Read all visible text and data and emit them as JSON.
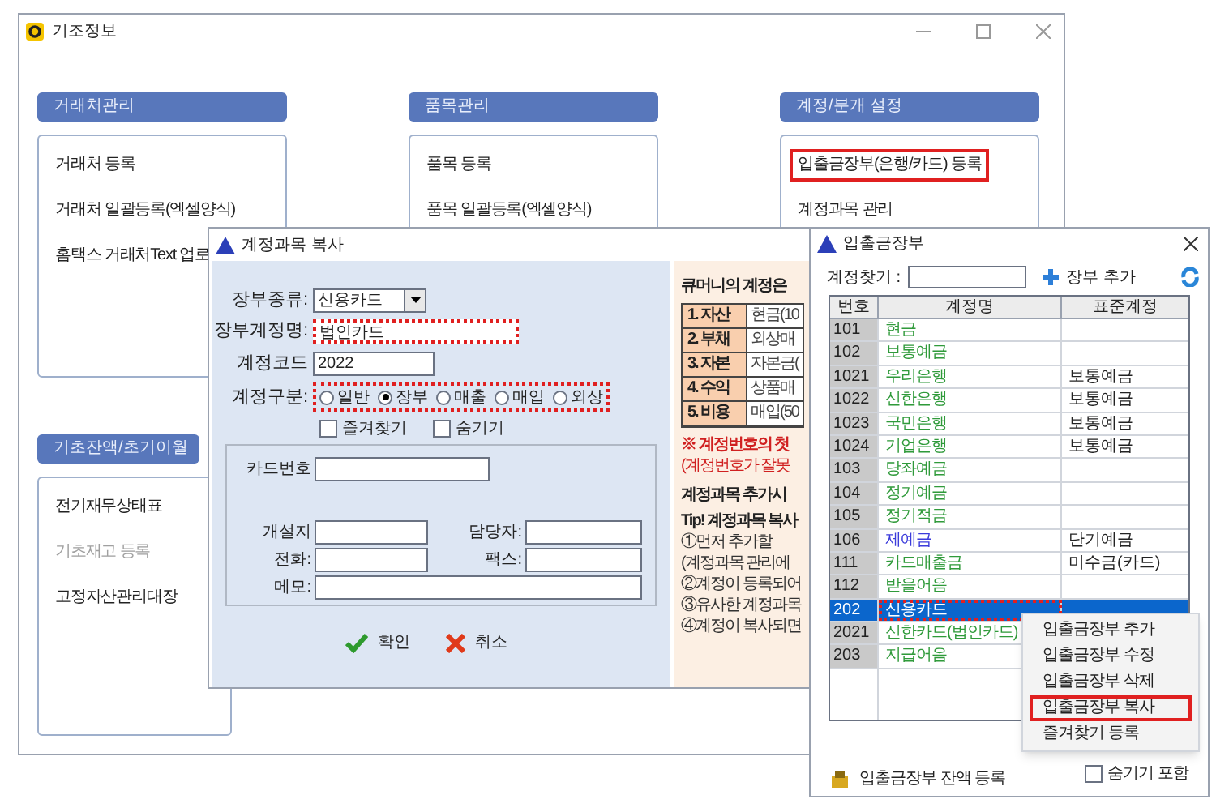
{
  "window": {
    "title": "기조정보"
  },
  "sections": [
    {
      "title": "거래처관리",
      "items": [
        {
          "label": "거래처 등록",
          "disabled": false,
          "highlighted": false
        },
        {
          "label": "거래처 일괄등록(엑셀양식)",
          "disabled": false,
          "highlighted": false
        },
        {
          "label": "홈택스 거래처Text 업로",
          "disabled": false,
          "highlighted": false
        }
      ]
    },
    {
      "title": "품목관리",
      "items": [
        {
          "label": "품목 등록",
          "disabled": false,
          "highlighted": false
        },
        {
          "label": "품목 일괄등록(엑셀양식)",
          "disabled": false,
          "highlighted": false
        }
      ]
    },
    {
      "title": "계정/분개 설정",
      "items": [
        {
          "label": "입출금장부(은행/카드) 등록",
          "disabled": false,
          "highlighted": true
        },
        {
          "label": "계정과목 관리",
          "disabled": false,
          "highlighted": false
        }
      ]
    },
    {
      "title": "기초잔액/초기이월",
      "items": [
        {
          "label": "전기재무상태표",
          "disabled": false,
          "highlighted": false
        },
        {
          "label": "기초재고 등록",
          "disabled": true,
          "highlighted": false
        },
        {
          "label": "고정자산관리대장",
          "disabled": false,
          "highlighted": false
        }
      ]
    }
  ],
  "copy_dialog": {
    "title": "계정과목 복사",
    "book_type": {
      "label": "장부종류:",
      "value": "신용카드"
    },
    "account_name": {
      "label": "장부계정명:",
      "value": "법인카드",
      "highlighted": true
    },
    "account_code": {
      "label": "계정코드",
      "value": "2022"
    },
    "account_class": {
      "label": "계정구분:",
      "highlighted": true,
      "options": [
        {
          "label": "일반",
          "selected": false
        },
        {
          "label": "장부",
          "selected": true
        },
        {
          "label": "매출",
          "selected": false
        },
        {
          "label": "매입",
          "selected": false
        },
        {
          "label": "외상",
          "selected": false
        }
      ]
    },
    "checkboxes": [
      {
        "label": "즐겨찾기",
        "checked": false
      },
      {
        "label": "숨기기",
        "checked": false
      }
    ],
    "card_number": {
      "label": "카드번호"
    },
    "fields": [
      {
        "label": "개설지"
      },
      {
        "label": "담당자:"
      },
      {
        "label": "전화:"
      },
      {
        "label": "팩스:"
      },
      {
        "label": "메모:"
      }
    ],
    "buttons": [
      {
        "label": "확인",
        "kind": "ok"
      },
      {
        "label": "취소",
        "kind": "cancel"
      }
    ],
    "guide": {
      "title": "큐머니의 계정은",
      "rows": [
        {
          "group": "1. 자산",
          "example": "현금(10"
        },
        {
          "group": "2. 부채",
          "example": "외상매"
        },
        {
          "group": "3. 자본",
          "example": "자본금("
        },
        {
          "group": "4. 수익",
          "example": "상품매"
        },
        {
          "group": "5. 비용",
          "example": "매입(50"
        }
      ],
      "warning": [
        "※ 계정번호의 첫",
        "(계정번호가 잘못"
      ],
      "heading": "계정과목 추가시",
      "tip_title": "Tip! 계정과목 복사",
      "tips": [
        "①먼저 추가할",
        "(계정과목 관리에",
        "②계정이 등록되어",
        "③유사한 계정과목",
        "④계정이 복사되면"
      ]
    }
  },
  "ledger_window": {
    "title": "입출금장부",
    "search_label": "계정찾기 :",
    "add_button": "장부 추가",
    "columns": [
      "번호",
      "계정명",
      "표준계정"
    ],
    "rows": [
      {
        "code": "101",
        "name": "현금",
        "color": "#2f9a3a",
        "selected": false
      },
      {
        "code": "102",
        "name": "보통예금",
        "color": "#2f9a3a",
        "selected": false
      },
      {
        "code": "1021",
        "name": "우리은행",
        "standard": "보통예금",
        "color": "#2f9a3a",
        "selected": false
      },
      {
        "code": "1022",
        "name": "신한은행",
        "standard": "보통예금",
        "color": "#2f9a3a",
        "selected": false
      },
      {
        "code": "1023",
        "name": "국민은행",
        "standard": "보통예금",
        "color": "#2f9a3a",
        "selected": false
      },
      {
        "code": "1024",
        "name": "기업은행",
        "standard": "보통예금",
        "color": "#2f9a3a",
        "selected": false
      },
      {
        "code": "103",
        "name": "당좌예금",
        "color": "#2f9a3a",
        "selected": false
      },
      {
        "code": "104",
        "name": "정기예금",
        "color": "#2f9a3a",
        "selected": false
      },
      {
        "code": "105",
        "name": "정기적금",
        "color": "#2f9a3a",
        "selected": false
      },
      {
        "code": "106",
        "name": "제예금",
        "standard": "단기예금",
        "color": "#3b3bdb",
        "selected": false
      },
      {
        "code": "111",
        "name": "카드매출금",
        "standard": "미수금(카드)",
        "color": "#2f9a3a",
        "selected": false
      },
      {
        "code": "112",
        "name": "받을어음",
        "color": "#2f9a3a",
        "selected": false
      },
      {
        "code": "202",
        "name": "신용카드",
        "selected": true
      },
      {
        "code": "2021",
        "name": "신한카드(법인카드)",
        "color": "#2f9a3a",
        "selected": false
      },
      {
        "code": "203",
        "name": "지급어음",
        "color": "#2f9a3a",
        "selected": false
      }
    ],
    "balance_button": "입출금장부 잔액 등록",
    "hidden_checkbox": {
      "label": "숨기기 포함",
      "checked": false
    }
  },
  "context_menu": [
    {
      "label": "입출금장부 추가",
      "highlighted": false
    },
    {
      "label": "입출금장부 수정",
      "highlighted": false
    },
    {
      "label": "입출금장부 삭제",
      "highlighted": false
    },
    {
      "label": "입출금장부 복사",
      "highlighted": true
    },
    {
      "label": "즐겨찾기 등록",
      "highlighted": false
    }
  ]
}
